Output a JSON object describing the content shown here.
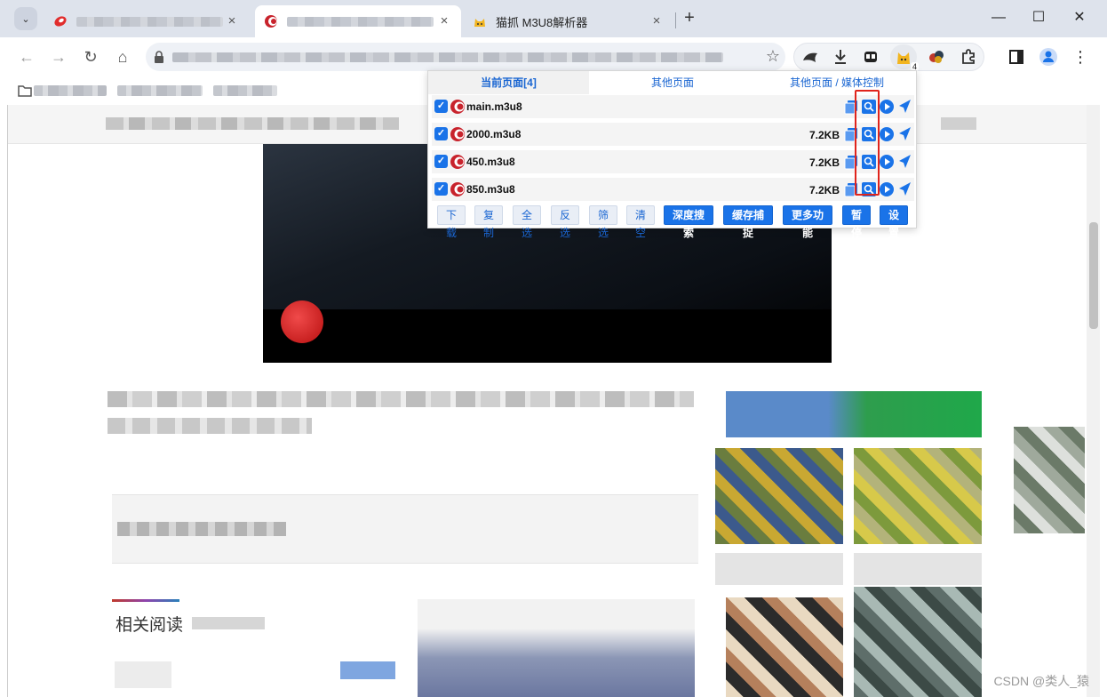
{
  "tabs": [
    {
      "title": "",
      "state": "inactive"
    },
    {
      "title": "",
      "state": "active"
    },
    {
      "title": "猫抓 M3U8解析器",
      "state": "inactive"
    }
  ],
  "tab_icons": {
    "close": "×",
    "new_tab": "+",
    "tab_search": "⌄"
  },
  "window_controls": {
    "minimize": "—",
    "maximize": "☐",
    "close": "✕"
  },
  "toolbar": {
    "back": "←",
    "forward": "→",
    "reload": "↻",
    "home": "⌂",
    "bookmark_star": "☆",
    "extensions_badge": "4",
    "menu": "⋮"
  },
  "popup": {
    "tabs": [
      "当前页面[4]",
      "其他页面",
      "其他页面 / 媒体控制"
    ],
    "rows": [
      {
        "name": "main.m3u8",
        "size": "",
        "checked": true
      },
      {
        "name": "2000.m3u8",
        "size": "7.2KB",
        "checked": true
      },
      {
        "name": "450.m3u8",
        "size": "7.2KB",
        "checked": true
      },
      {
        "name": "850.m3u8",
        "size": "7.2KB",
        "checked": true
      }
    ],
    "check_mark": "✓",
    "buttons_light": [
      "下载",
      "复制",
      "全选",
      "反选",
      "筛选",
      "清空"
    ],
    "buttons_solid": [
      "深度搜索",
      "缓存捕捉",
      "更多功能",
      "暂停",
      "设置"
    ]
  },
  "page": {
    "related_label": "相关阅读",
    "watermark": "CSDN @类人_猿"
  },
  "colors": {
    "accent": "#1a73e8",
    "highlight": "#e0241c",
    "tabstrip": "#dee3ec"
  }
}
